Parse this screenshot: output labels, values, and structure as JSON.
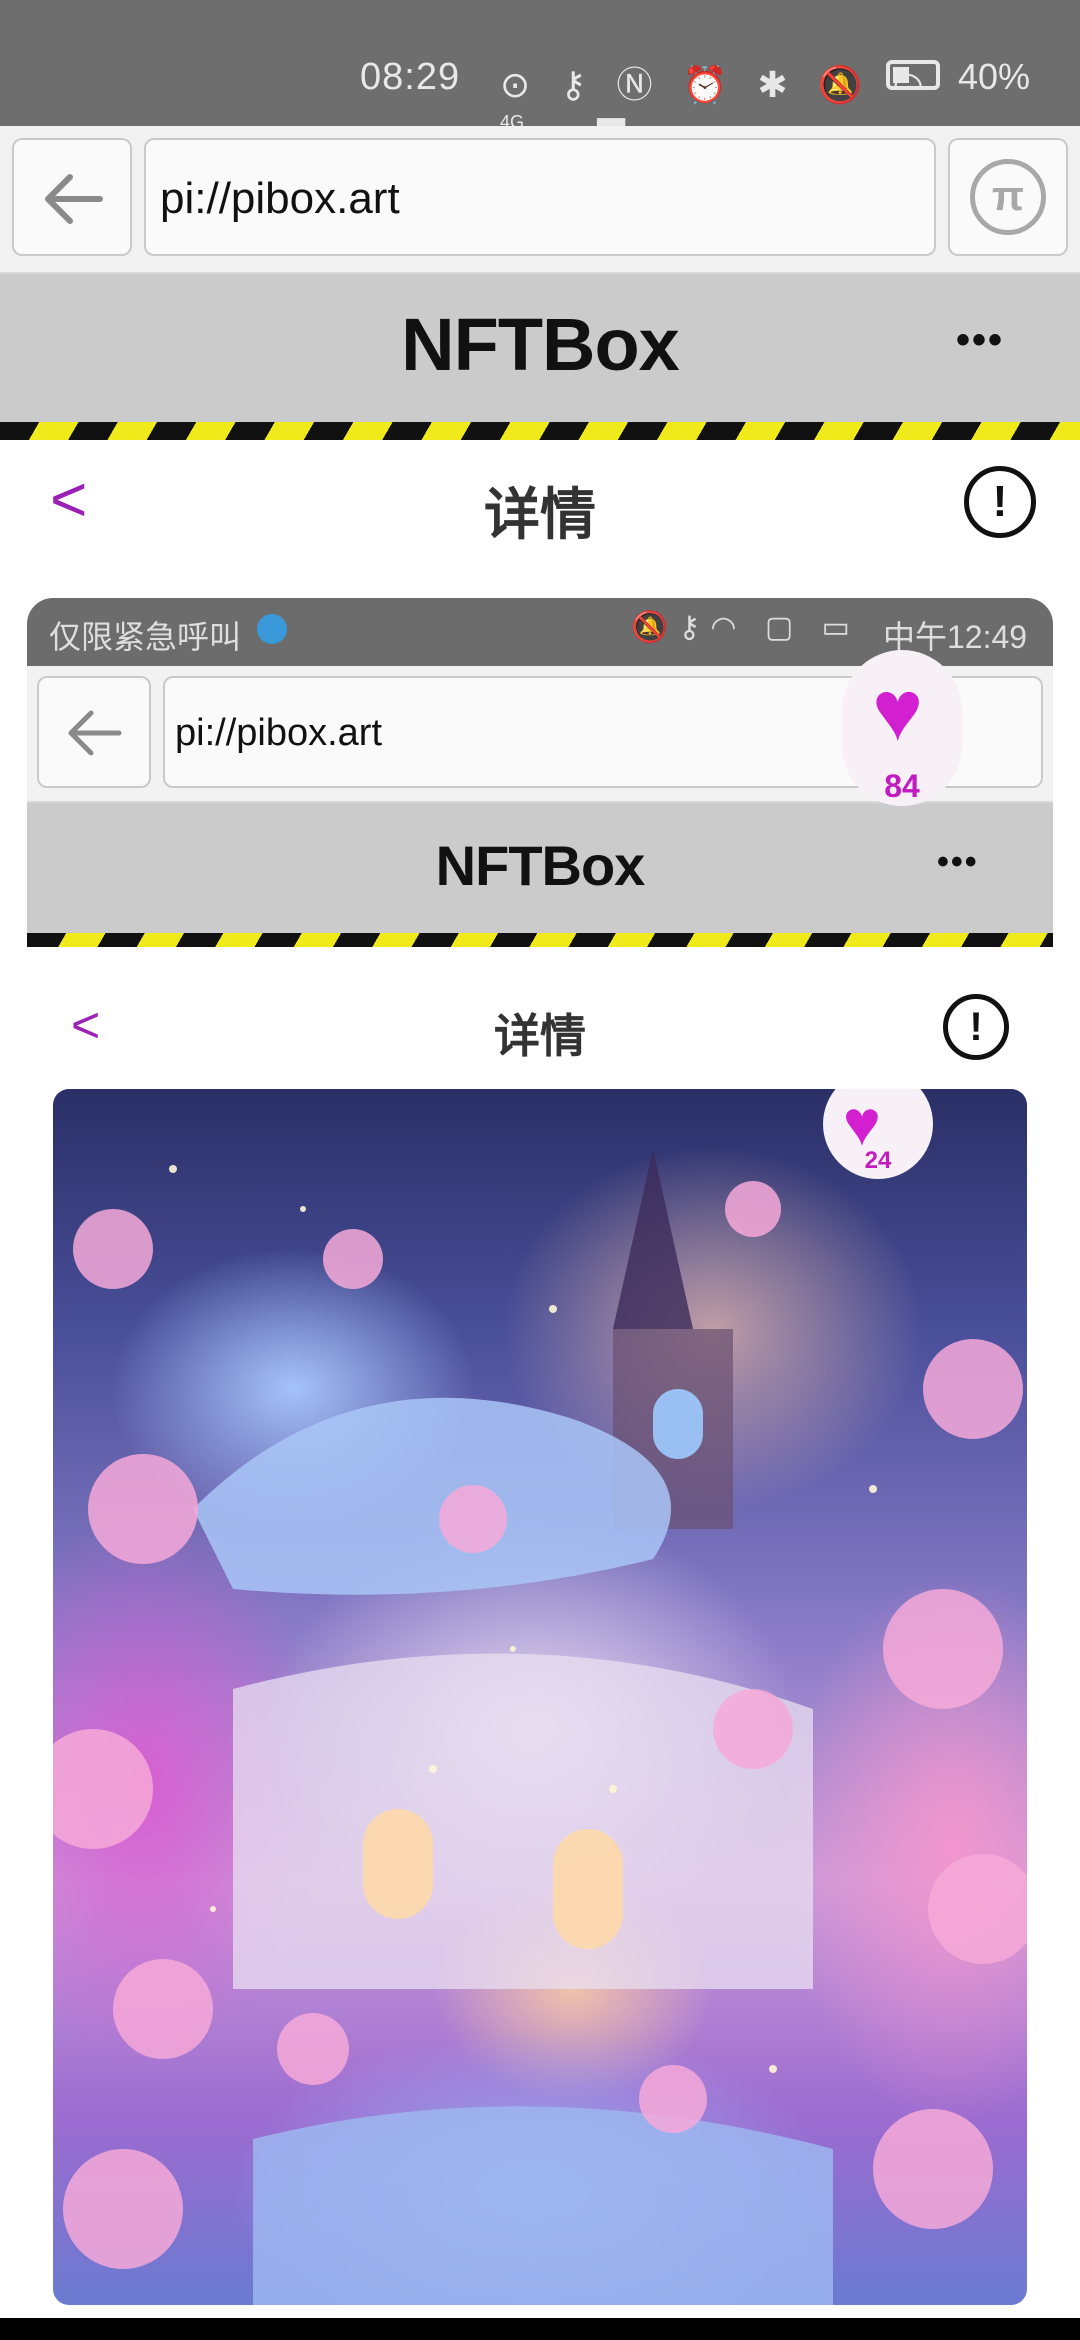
{
  "status_bar": {
    "time": "08:29",
    "icons": [
      "data-saver-icon",
      "key-icon",
      "nfc-icon",
      "alarm-icon",
      "bluetooth-icon",
      "mute-icon",
      "wifi-icon",
      "signal-icon",
      "battery-icon"
    ],
    "network": "4G",
    "battery": "40%"
  },
  "browser": {
    "url": "pi://pibox.art",
    "back_icon": "arrow-left-icon",
    "pi_icon": "pi-logo-icon",
    "pi_glyph": "π"
  },
  "app_header": {
    "brand": "NFTBox",
    "more": "•••"
  },
  "page": {
    "back": "<",
    "title": "详情",
    "info": "!"
  },
  "nested_screenshot": {
    "status_bar": {
      "left_text": "仅限紧急呼叫",
      "time": "中午12:49"
    },
    "browser": {
      "url": "pi://pibox.art"
    },
    "app_header": {
      "brand": "NFTBox",
      "more": "•••"
    },
    "page": {
      "back": "<",
      "title": "详情",
      "info": "!"
    },
    "artwork_likes": "24"
  },
  "like_badge": {
    "count": "84"
  },
  "colors": {
    "accent_purple": "#9b20b5",
    "heart_magenta": "#d21fd0",
    "header_gray": "#cbcbcb",
    "hazard_yellow": "#f1ea1a"
  }
}
